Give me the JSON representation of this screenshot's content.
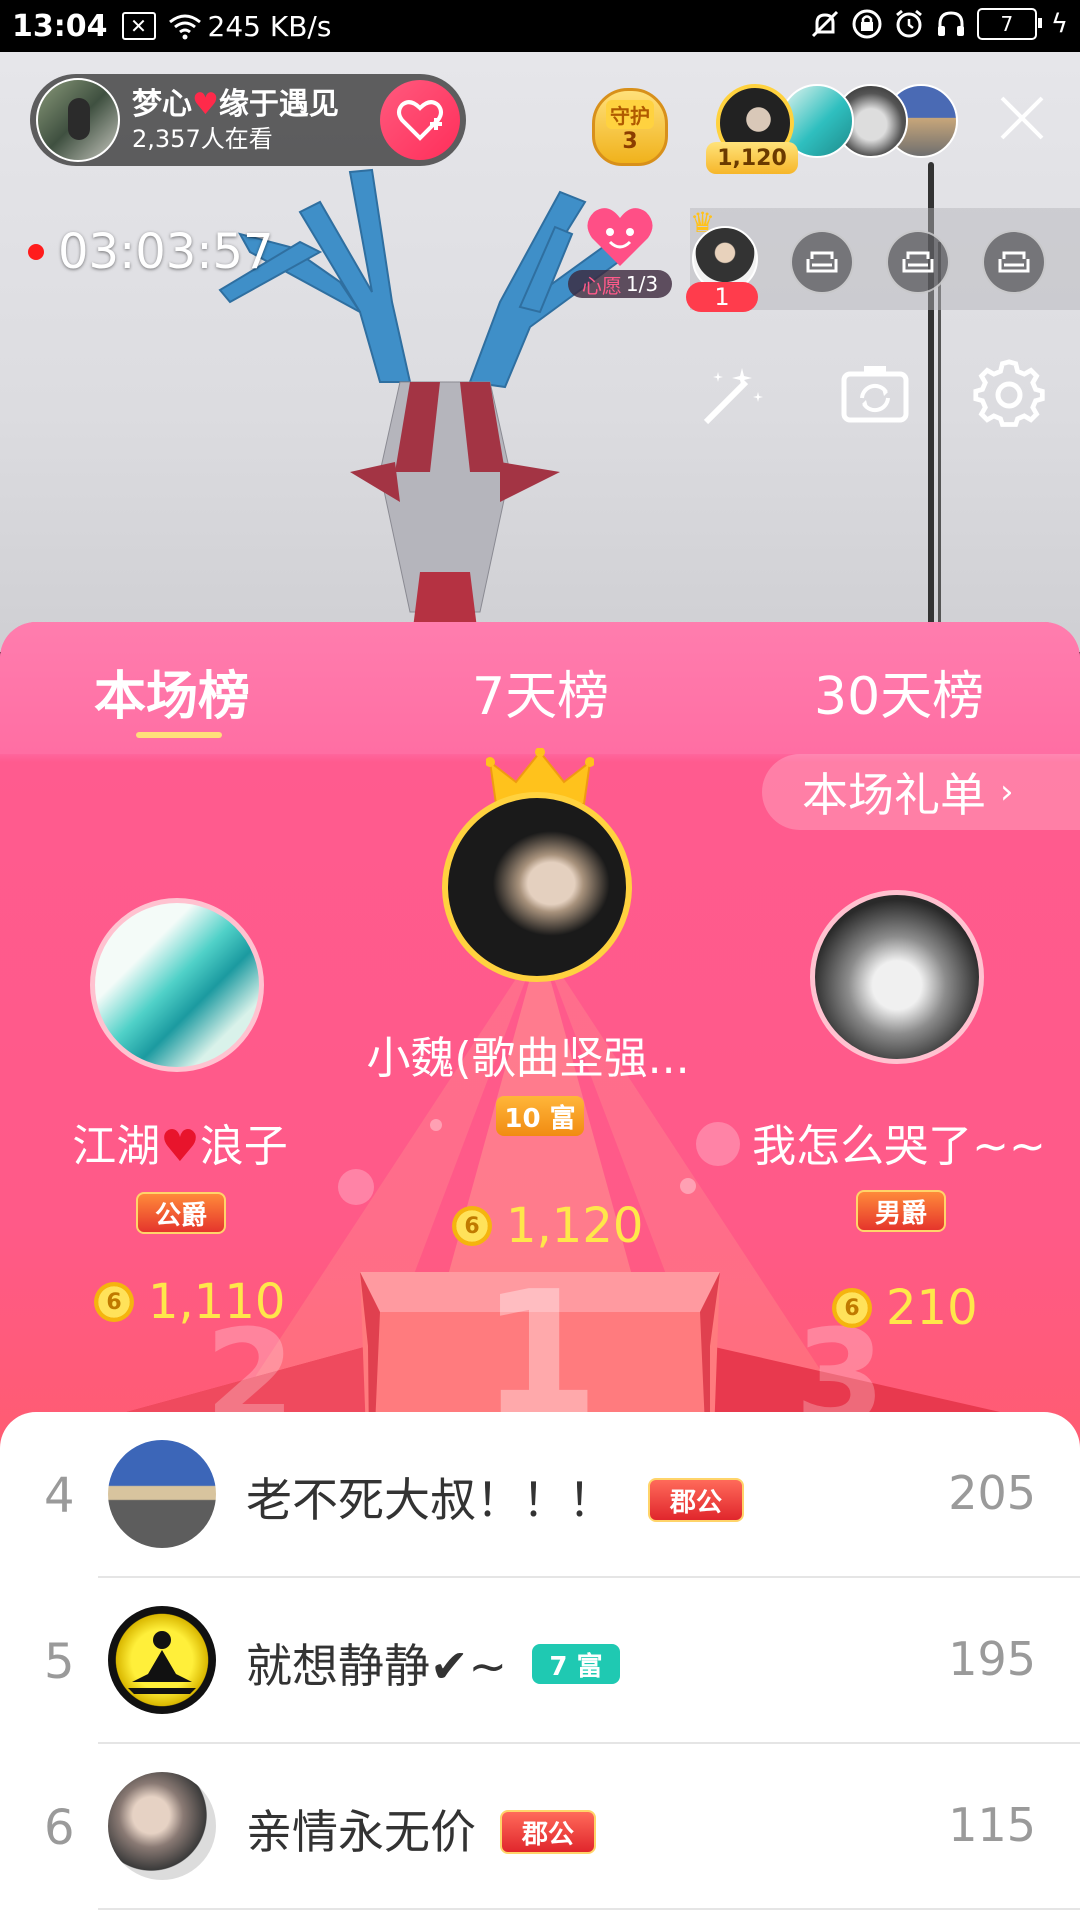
{
  "status_bar": {
    "time": "13:04",
    "net_speed": "245 KB/s",
    "battery": "7",
    "notification_icon": "x-notification-icon"
  },
  "live": {
    "host_name_left": "梦心",
    "host_name_right": "缘于遇见",
    "viewers": "2,357人在看",
    "guard_label": "守护",
    "guard_count": "3",
    "top_contrib_value": "1,120",
    "duration": "03:03:57",
    "wish_label": "心愿",
    "wish_progress": "1/3",
    "seat_rank": "1"
  },
  "leaderboard": {
    "tabs": [
      "本场榜",
      "7天榜",
      "30天榜"
    ],
    "active_tab": 0,
    "gift_list_label": "本场礼单",
    "podium": [
      {
        "rank": 1,
        "name": "小魏(歌曲坚强...",
        "badge": "10 富",
        "score": "1,120"
      },
      {
        "rank": 2,
        "name_left": "江湖",
        "name_right": "浪子",
        "badge": "公爵",
        "score": "1,110"
      },
      {
        "rank": 3,
        "name": "我怎么哭了~~",
        "badge": "男爵",
        "score": "210"
      }
    ],
    "podium_numbers": [
      "1",
      "2",
      "3"
    ],
    "rows": [
      {
        "rank": "4",
        "name": "老不死大叔！！！",
        "badge": "郡公",
        "score": "205"
      },
      {
        "rank": "5",
        "name": "就想静静✔~",
        "badge": "7 富",
        "score": "195"
      },
      {
        "rank": "6",
        "name": "亲情永无价",
        "badge": "郡公",
        "score": "115"
      }
    ]
  },
  "colors": {
    "accent_pink": "#ff5a88",
    "gold": "#ffe74a",
    "live_red": "#ff1c1c"
  }
}
